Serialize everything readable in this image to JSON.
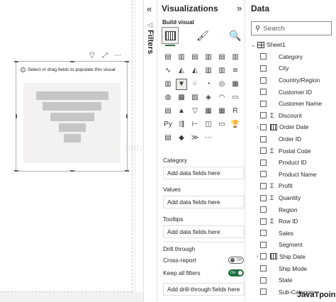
{
  "canvas": {
    "visual_message": "Select or drag fields to populate this visual",
    "funnel_bars": [
      0.95,
      0.78,
      0.58,
      0.36,
      0.22
    ]
  },
  "filters": {
    "label": "Filters"
  },
  "visualizations": {
    "title": "Visualizations",
    "build_visual_label": "Build visual",
    "sections": {
      "category_label": "Category",
      "category_placeholder": "Add data fields here",
      "values_label": "Values",
      "values_placeholder": "Add data fields here",
      "tooltips_label": "Tooltips",
      "tooltips_placeholder": "Add data fields here",
      "drill_through_label": "Drill through",
      "cross_report_label": "Cross-report",
      "cross_report_state": "Off",
      "keep_filters_label": "Keep all filters",
      "keep_filters_state": "On",
      "drill_placeholder": "Add drill-through fields here"
    },
    "icons": [
      "stacked-bar-chart",
      "stacked-column-chart",
      "clustered-bar-chart",
      "clustered-column-chart",
      "100-stacked-bar-chart",
      "100-stacked-column-chart",
      "line-chart",
      "area-chart",
      "stacked-area-chart",
      "line-stacked-column-chart",
      "line-clustered-column-chart",
      "ribbon-chart",
      "waterfall-chart",
      "funnel-chart",
      "scatter-chart",
      "pie-chart",
      "donut-chart",
      "treemap",
      "map",
      "filled-map",
      "shape-map",
      "azure-map",
      "gauge",
      "card",
      "multi-row-card",
      "kpi",
      "slicer",
      "table",
      "matrix",
      "r-visual",
      "python-visual",
      "key-influencers",
      "decomposition-tree",
      "qa",
      "smart-narrative",
      "goals",
      "paginated-report",
      "power-apps",
      "power-automate",
      "more-visuals"
    ],
    "icon_glyphs": [
      "▤",
      "▥",
      "▤",
      "▥",
      "▤",
      "▥",
      "∿",
      "◭",
      "◭",
      "▥",
      "▥",
      "≋",
      "▥",
      "▼",
      "⁘",
      "◔",
      "◎",
      "▦",
      "◍",
      "▩",
      "▨",
      "◈",
      "◠",
      "▭",
      "▤",
      "▲",
      "▽",
      "▦",
      "▦",
      "R",
      "Py",
      "⇶",
      "⊢",
      "◫",
      "▭",
      "🏆",
      "▤",
      "◆",
      "≫",
      "⋯"
    ]
  },
  "data": {
    "title": "Data",
    "search_placeholder": "Search",
    "table_name": "Sheet1",
    "fields": [
      {
        "name": "Category",
        "type": "text"
      },
      {
        "name": "City",
        "type": "text"
      },
      {
        "name": "Country/Region",
        "type": "text"
      },
      {
        "name": "Customer ID",
        "type": "text"
      },
      {
        "name": "Customer Name",
        "type": "text"
      },
      {
        "name": "Discount",
        "type": "sum"
      },
      {
        "name": "Order Date",
        "type": "date"
      },
      {
        "name": "Order ID",
        "type": "text"
      },
      {
        "name": "Postal Code",
        "type": "sum"
      },
      {
        "name": "Product ID",
        "type": "text"
      },
      {
        "name": "Product Name",
        "type": "text"
      },
      {
        "name": "Profit",
        "type": "sum"
      },
      {
        "name": "Quantity",
        "type": "sum"
      },
      {
        "name": "Region",
        "type": "text"
      },
      {
        "name": "Row ID",
        "type": "sum"
      },
      {
        "name": "Sales",
        "type": "text"
      },
      {
        "name": "Segment",
        "type": "text"
      },
      {
        "name": "Ship Date",
        "type": "date"
      },
      {
        "name": "Ship Mode",
        "type": "text"
      },
      {
        "name": "State",
        "type": "text"
      },
      {
        "name": "Sub-Category",
        "type": "text"
      }
    ]
  },
  "watermark": "javatpoint",
  "logo": "JavaTpoint"
}
